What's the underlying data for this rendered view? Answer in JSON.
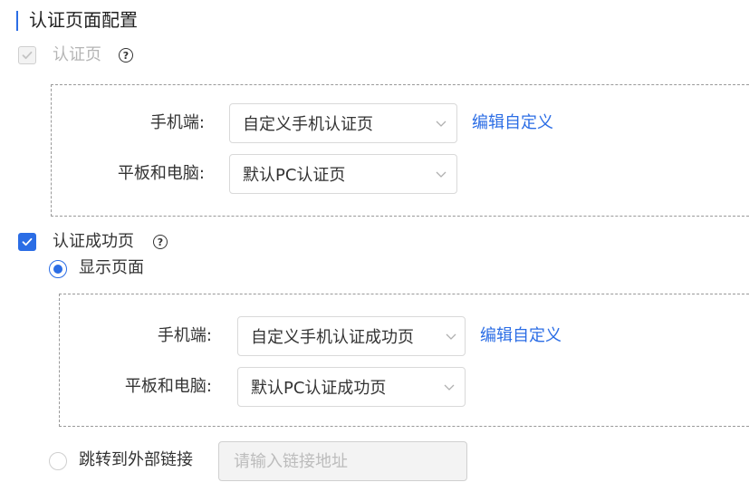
{
  "section": {
    "title": "认证页面配置"
  },
  "auth_page": {
    "label": "认证页",
    "checked": true,
    "disabled": true,
    "mobile": {
      "label": "手机端:",
      "value": "自定义手机认证页",
      "edit_link": "编辑自定义"
    },
    "desktop": {
      "label": "平板和电脑:",
      "value": "默认PC认证页"
    }
  },
  "auth_success_page": {
    "label": "认证成功页",
    "checked": true,
    "options": {
      "show_page": {
        "label": "显示页面",
        "selected": true,
        "mobile": {
          "label": "手机端:",
          "value": "自定义手机认证成功页",
          "edit_link": "编辑自定义"
        },
        "desktop": {
          "label": "平板和电脑:",
          "value": "默认PC认证成功页"
        }
      },
      "redirect": {
        "label": "跳转到外部链接",
        "selected": false,
        "input_placeholder": "请输入链接地址",
        "input_value": ""
      }
    }
  },
  "icons": {
    "help": "question-circle-icon",
    "check": "check-icon",
    "chevron": "chevron-down-icon"
  },
  "colors": {
    "accent": "#2b6de5",
    "disabled_text": "#b5b5b5",
    "border": "#d9d9d9"
  }
}
